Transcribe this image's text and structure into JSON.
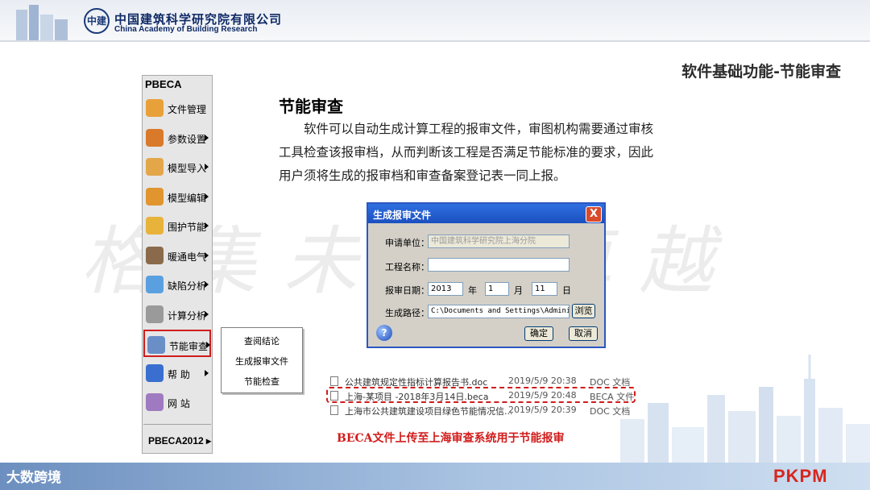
{
  "header": {
    "logo_text": "中建",
    "org_cn": "中国建筑科学研究院有限公司",
    "org_en": "China Academy of Building Research"
  },
  "section_title": "软件基础功能-节能审查",
  "watermark": "格集未来 卓越",
  "sidebar": {
    "title": "PBECA",
    "items": [
      {
        "label": "文件管理",
        "icon": "file-manage-icon",
        "color": "#e8a13a",
        "arrow": false
      },
      {
        "label": "参数设置",
        "icon": "params-icon",
        "color": "#d97a2a",
        "arrow": true
      },
      {
        "label": "模型导入",
        "icon": "model-import-icon",
        "color": "#e3a74a",
        "arrow": true
      },
      {
        "label": "模型编辑",
        "icon": "model-edit-icon",
        "color": "#e0952f",
        "arrow": true
      },
      {
        "label": "围护节能",
        "icon": "envelope-icon",
        "color": "#e8b33a",
        "arrow": true
      },
      {
        "label": "暖通电气",
        "icon": "hvac-icon",
        "color": "#8a6a4a",
        "arrow": true
      },
      {
        "label": "缺陷分析",
        "icon": "defect-icon",
        "color": "#5aa0e0",
        "arrow": true
      },
      {
        "label": "计算分析",
        "icon": "calc-icon",
        "color": "#9a9a9a",
        "arrow": true
      },
      {
        "label": "节能审查",
        "icon": "energy-review-icon",
        "color": "#6a8fc7",
        "arrow": true
      },
      {
        "label": "帮  助",
        "icon": "help-icon",
        "color": "#3a6fd0",
        "arrow": true
      },
      {
        "label": "网  站",
        "icon": "website-icon",
        "color": "#a07ac0",
        "arrow": false
      }
    ],
    "bottom": "PBECA2012"
  },
  "popup": [
    "查阅结论",
    "生成报审文件",
    "节能检查"
  ],
  "content": {
    "heading": "节能审查",
    "paragraph": "软件可以自动生成计算工程的报审文件，审图机构需要通过审核工具检查该报审档，从而判断该工程是否满足节能标准的要求，因此用户须将生成的报审档和审查备案登记表一同上报。"
  },
  "dialog": {
    "title": "生成报审文件",
    "close": "X",
    "unit_label": "申请单位：",
    "unit_value": "中国建筑科学研究院上海分院",
    "project_label": "工程名称：",
    "project_value": "",
    "date_label": "报审日期：",
    "year": "2013",
    "year_unit": "年",
    "month": "1",
    "month_unit": "月",
    "day": "11",
    "day_unit": "日",
    "path_label": "生成路径：",
    "path_value": "C:\\Documents and Settings\\Administ",
    "browse": "浏览",
    "ok": "确定",
    "cancel": "取消",
    "help": "?"
  },
  "files": [
    {
      "name": "公共建筑规定性指标计算报告书.doc",
      "date": "2019/5/9 20:38",
      "type": "DOC 文档"
    },
    {
      "name": "上海-某项目 -2018年3月14日.beca",
      "date": "2019/5/9 20:48",
      "type": "BECA 文件"
    },
    {
      "name": "上海市公共建筑建设项目绿色节能情况信...",
      "date": "2019/5/9 20:39",
      "type": "DOC 文档"
    }
  ],
  "caption": "BECA文件上传至上海审查系统用于节能报审",
  "footer": {
    "brand": "大数跨境",
    "pkpm": "PKPM"
  }
}
